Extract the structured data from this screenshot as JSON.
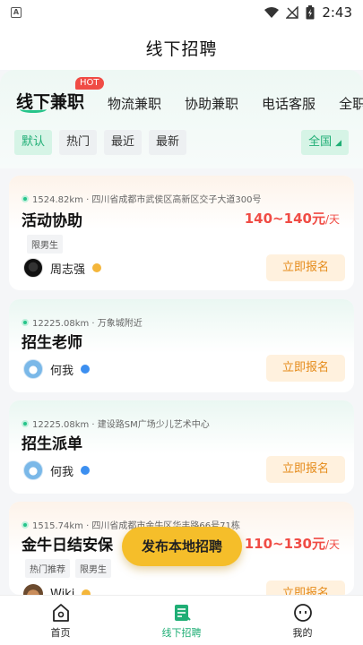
{
  "status_bar": {
    "time": "2:43",
    "left_icon_letter": "A"
  },
  "header": {
    "title": "线下招聘"
  },
  "tabs": {
    "items": [
      "线下兼职",
      "物流兼职",
      "协助兼职",
      "电话客服",
      "全职"
    ],
    "active_index": 0,
    "hot_badge": "HOT"
  },
  "sorts": {
    "items": [
      "默认",
      "热门",
      "最近",
      "最新"
    ],
    "active_index": 0
  },
  "region": {
    "label": "全国"
  },
  "jobs": [
    {
      "location": "1524.82km · 四川省成都市武侯区高新区交子大道300号",
      "title": "活动协助",
      "salary": "140~140元",
      "salary_unit": "/天",
      "tags": [
        "限男生"
      ],
      "poster": "周志强",
      "verify": "gold",
      "apply": "立即报名"
    },
    {
      "location": "12225.08km · 万象城附近",
      "title": "招生老师",
      "salary": "",
      "salary_unit": "",
      "tags": [],
      "poster": "何我",
      "verify": "blue",
      "apply": "立即报名"
    },
    {
      "location": "12225.08km · 建设路SM广场少儿艺术中心",
      "title": "招生派单",
      "salary": "",
      "salary_unit": "",
      "tags": [],
      "poster": "何我",
      "verify": "blue",
      "apply": "立即报名"
    },
    {
      "location": "1515.74km · 四川省成都市金牛区华丰路66号71栋",
      "title": "金牛日结安保",
      "salary": "110~130元",
      "salary_unit": "/天",
      "tags": [
        "热门推荐",
        "限男生"
      ],
      "poster": "Wiki",
      "verify": "gold",
      "apply": "立即报名"
    }
  ],
  "fab": {
    "label": "发布本地招聘"
  },
  "bottom_nav": {
    "items": [
      {
        "label": "首页",
        "icon": "home-icon"
      },
      {
        "label": "线下招聘",
        "icon": "recruit-document-icon"
      },
      {
        "label": "我的",
        "icon": "profile-face-icon"
      }
    ],
    "active_index": 1
  },
  "colors": {
    "accent_green": "#1fae75",
    "salary_red": "#f04c45",
    "fab_yellow": "#f5be2a",
    "apply_orange": "#e58b1a"
  }
}
